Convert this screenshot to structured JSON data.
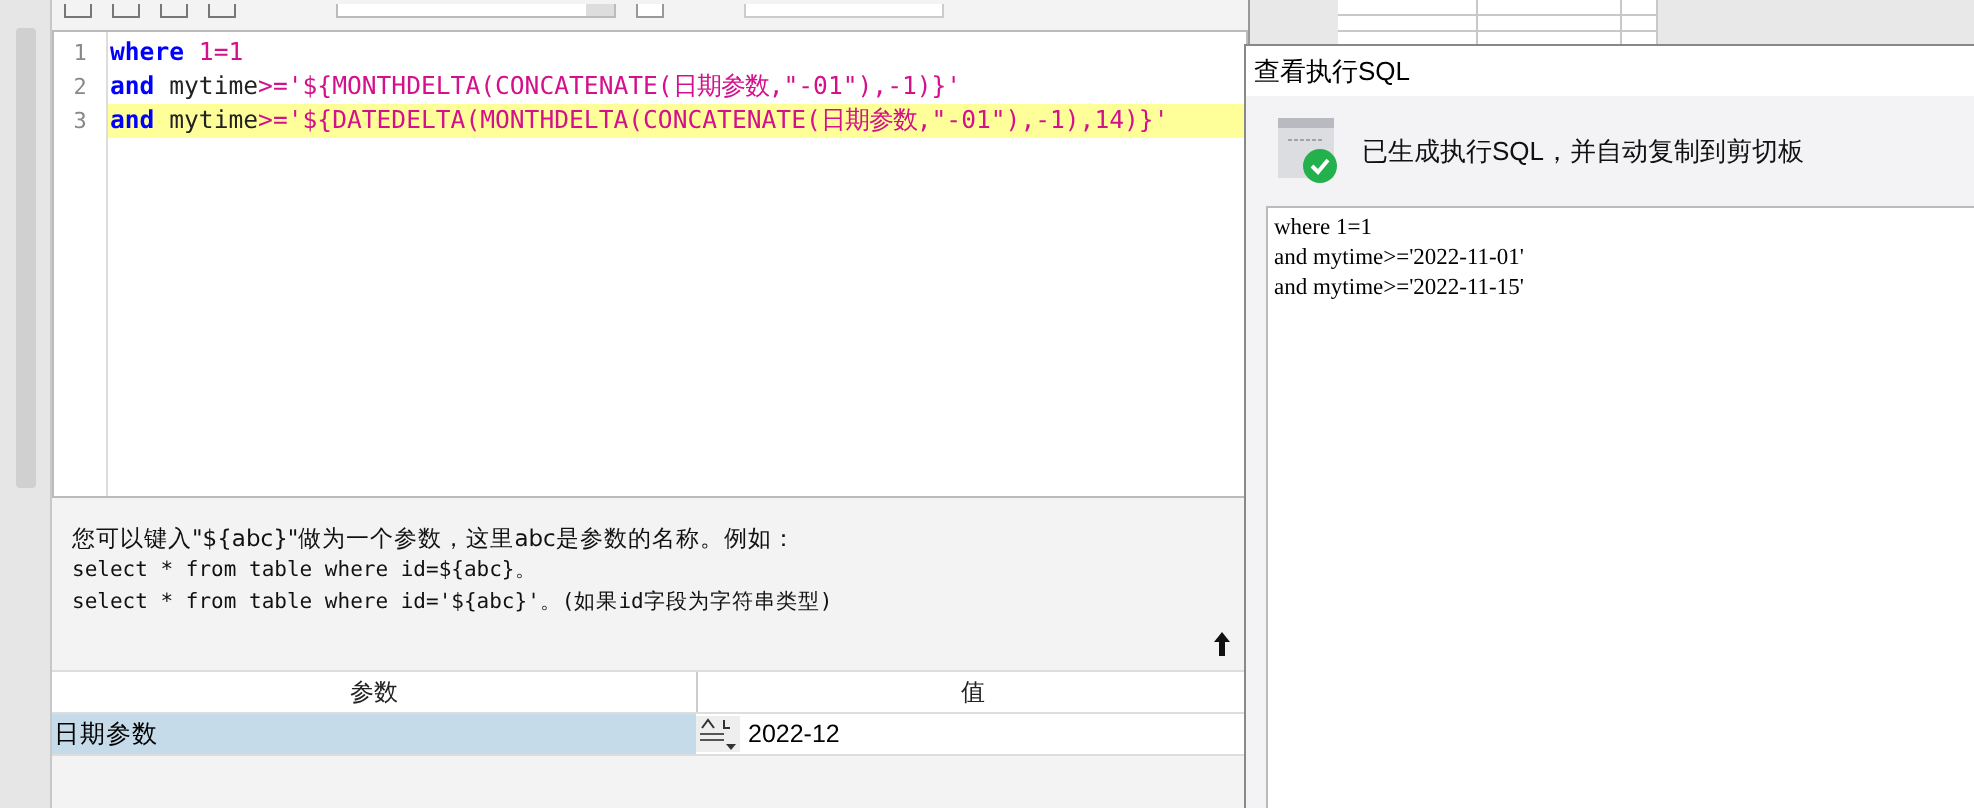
{
  "toolbar": {
    "wrap_checkbox": {
      "checked": false
    }
  },
  "editor": {
    "lines": [
      {
        "number": "1",
        "highlighted": false,
        "tokens": [
          {
            "kind": "keyword",
            "text": "where"
          },
          {
            "kind": "string",
            "text": " 1=1"
          }
        ]
      },
      {
        "number": "2",
        "highlighted": false,
        "tokens": [
          {
            "kind": "keyword",
            "text": "and"
          },
          {
            "kind": "plain",
            "text": " mytime"
          },
          {
            "kind": "string",
            "text": ">='${MONTHDELTA(CONCATENATE(日期参数,\"-01\"),-1)}'"
          }
        ]
      },
      {
        "number": "3",
        "highlighted": true,
        "tokens": [
          {
            "kind": "keyword",
            "text": "and"
          },
          {
            "kind": "plain",
            "text": " mytime"
          },
          {
            "kind": "string",
            "text": ">='${DATEDELTA(MONTHDELTA(CONCATENATE(日期参数,\"-01\"),-1),14)}'"
          }
        ]
      }
    ]
  },
  "help": {
    "lines": [
      "您可以键入\"${abc}\"做为一个参数，这里abc是参数的名称。例如：",
      "select * from table where id=${abc}。",
      "select * from table where id='${abc}'。(如果id字段为字符串类型)"
    ]
  },
  "params": {
    "columns": [
      "参数",
      "值"
    ],
    "rows": [
      {
        "name": "日期参数",
        "value": "2022-12",
        "selected": true
      }
    ]
  },
  "dialog": {
    "title": "查看执行SQL",
    "message": "已生成执行SQL，并自动复制到剪切板",
    "sql_lines": [
      "where 1=1",
      "and mytime>='2022-11-01'",
      "and mytime>='2022-11-15'"
    ]
  }
}
